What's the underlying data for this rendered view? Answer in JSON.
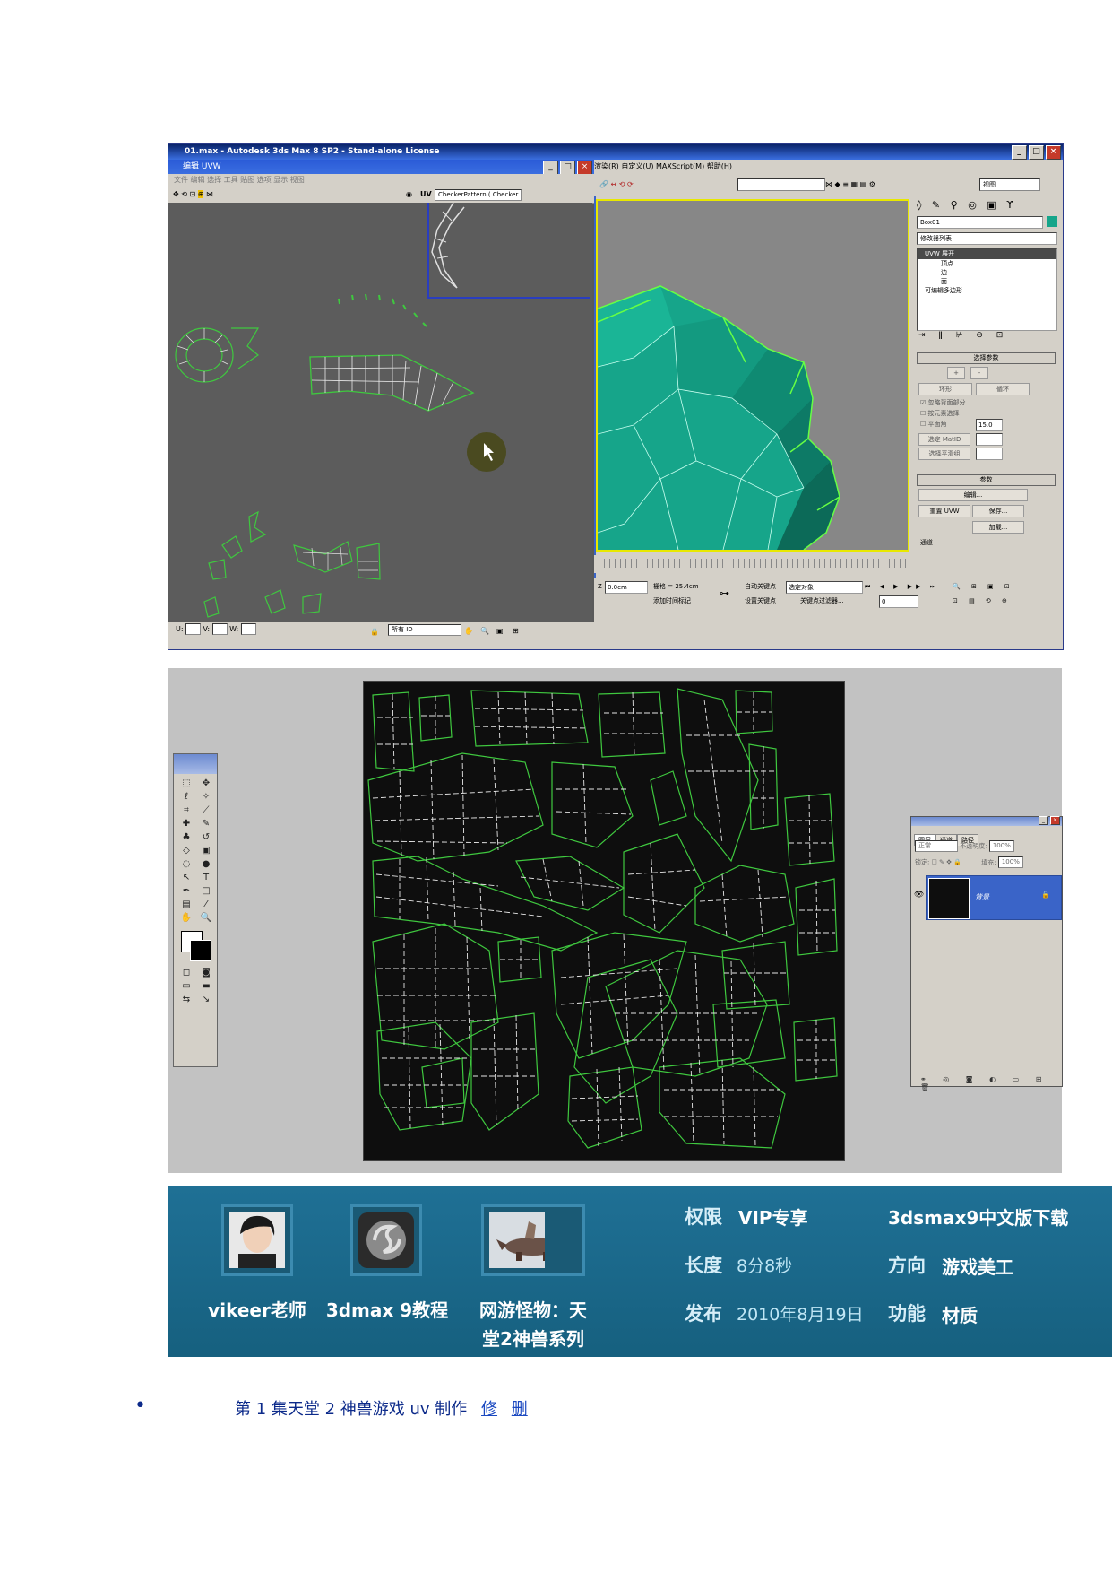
{
  "max_window": {
    "title": "01.max - Autodesk 3ds Max 8 SP2  - Stand-alone License",
    "uv_editor": {
      "title": "编辑 UVW",
      "menu": "文件  编辑  选择  工具  贴图  选项  显示  视图",
      "texture_label": "UV",
      "texture_combo": "CheckerPattern  ( Checker",
      "bottom_combo": "所有 ID"
    },
    "menubar": "渲染(R)   自定义(U)   MAXScript(M)   帮助(H)",
    "toolbar_view": "视图",
    "command_panel": {
      "object_name": "Box01",
      "modifier_list": "修改器列表",
      "stack": [
        "UVW 展开",
        "顶点",
        "边",
        "面",
        "可编辑多边形"
      ],
      "rollout_select": "选择参数",
      "select_buttons": [
        "+",
        "-",
        "环形",
        "循环"
      ],
      "checkbox_items": [
        "忽略背面部分",
        "按元素选择",
        "平面角"
      ],
      "plane_angle": "15.0",
      "matid_btn": "选定 MatID",
      "smooth_btn": "选择平滑组",
      "rollout_params": "参数",
      "edit_btn": "编辑...",
      "reset_btn": "重置 UVW",
      "save_btn": "保存...",
      "load_btn": "加载...",
      "channel_label": "通道"
    },
    "status": {
      "x_field": "0.0cm",
      "grid": "栅格 = 25.4cm",
      "auto_key": "自动关键点",
      "selected_object": "选定对象",
      "set_key": "设置关键点",
      "key_filter": "关键点过滤器...",
      "add_tag": "添加时间标记",
      "frame": "0"
    }
  },
  "photoshop": {
    "layers_tabs": [
      "图层",
      "通道",
      "路径"
    ],
    "blend_mode": "正常",
    "opacity_label": "不透明度:",
    "opacity_value": "100%",
    "lock_label": "锁定:",
    "fill_label": "填充:",
    "fill_value": "100%",
    "layer_name": "背景"
  },
  "banner": {
    "thumbs": [
      {
        "caption": "vikeer老师",
        "icon": "teacher-avatar-icon"
      },
      {
        "caption": "3dmax 9教程",
        "icon": "3dsmax-logo-icon"
      },
      {
        "caption": "网游怪物：天堂2神兽系列",
        "icon": "monster-render-icon"
      }
    ],
    "meta": {
      "permission_label": "权限",
      "permission_value": "VIP专享",
      "length_label": "长度",
      "length_value": "8分8秒",
      "publish_label": "发布",
      "publish_value": "2010年8月19日",
      "download": "3dsmax9中文版下载",
      "direction_label": "方向",
      "direction_value": "游戏美工",
      "feature_label": "功能",
      "feature_value": "材质"
    },
    "colors": {
      "background": "#1f7095",
      "accent": "#3c8bb0"
    }
  },
  "episode": {
    "title": "第 1 集天堂 2 神兽游戏 uv 制作",
    "edit_link": "修",
    "delete_link": "删"
  }
}
